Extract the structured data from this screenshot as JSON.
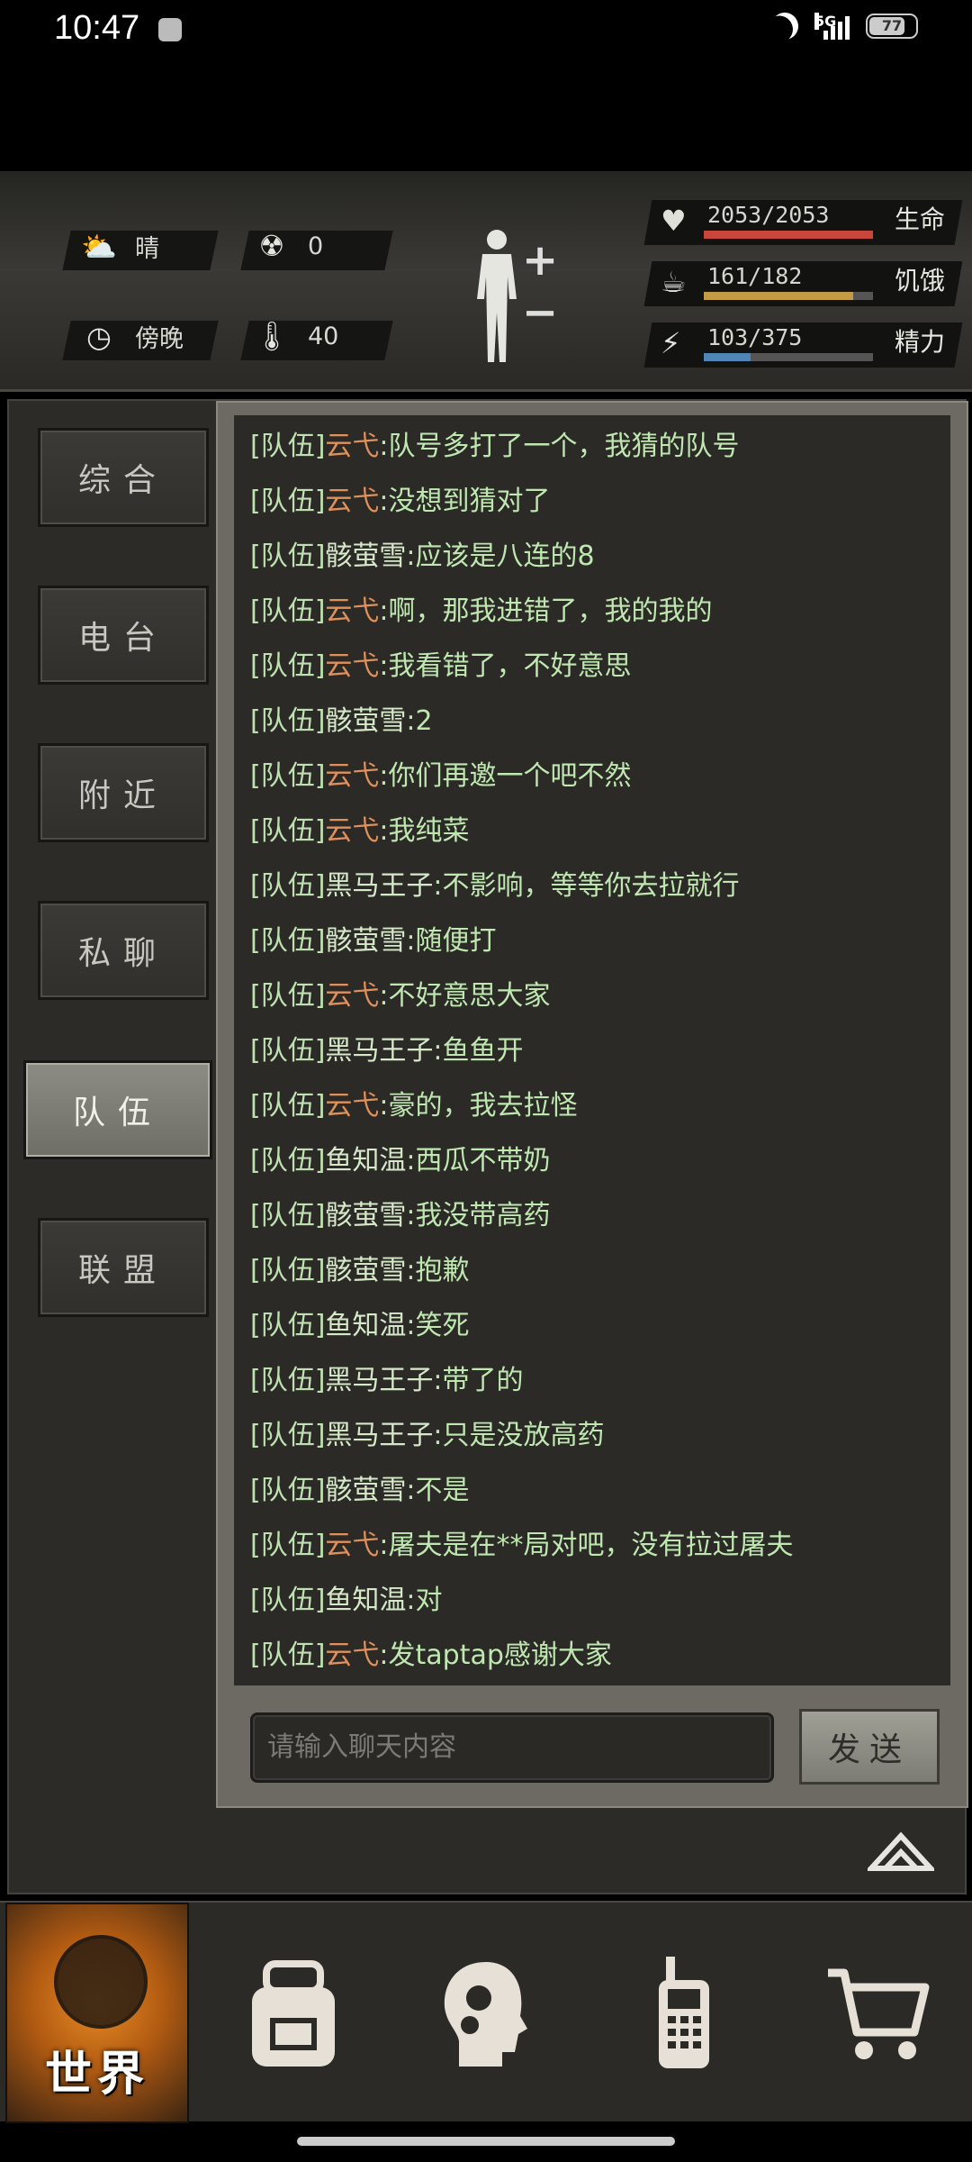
{
  "status_bar": {
    "time": "10:47",
    "network": "5G",
    "battery": "77"
  },
  "header": {
    "weather": {
      "icon": "cloud-sun-icon",
      "value": "晴"
    },
    "radiation": {
      "icon": "radiation-icon",
      "value": "0"
    },
    "time_of_day": {
      "icon": "clock-icon",
      "value": "傍晚"
    },
    "temperature": {
      "icon": "thermometer-icon",
      "value": "40"
    },
    "stats": [
      {
        "name": "生命",
        "value": "2053/2053",
        "fraction": 1.0,
        "color": "#c9473a",
        "icon": "heart-pulse-icon"
      },
      {
        "name": "饥饿",
        "value": "161/182",
        "fraction": 0.885,
        "color": "#c39a45",
        "icon": "stomach-icon"
      },
      {
        "name": "精力",
        "value": "103/375",
        "fraction": 0.275,
        "color": "#4f86b6",
        "icon": "energy-head-icon"
      }
    ]
  },
  "tabs": [
    {
      "label": "综合",
      "active": false
    },
    {
      "label": "电台",
      "active": false
    },
    {
      "label": "附近",
      "active": false
    },
    {
      "label": "私聊",
      "active": false
    },
    {
      "label": "队伍",
      "active": true
    },
    {
      "label": "联盟",
      "active": false
    }
  ],
  "messages": [
    {
      "tag": "[队伍]",
      "user": "云弋",
      "highlight": true,
      "text": ":队号多打了一个，我猜的队号"
    },
    {
      "tag": "[队伍]",
      "user": "云弋",
      "highlight": true,
      "text": ":没想到猜对了"
    },
    {
      "tag": "[队伍]",
      "user": "骸萤雪",
      "highlight": false,
      "text": ":应该是八连的8"
    },
    {
      "tag": "[队伍]",
      "user": "云弋",
      "highlight": true,
      "text": ":啊，那我进错了，我的我的"
    },
    {
      "tag": "[队伍]",
      "user": "云弋",
      "highlight": true,
      "text": ":我看错了，不好意思"
    },
    {
      "tag": "[队伍]",
      "user": "骸萤雪",
      "highlight": false,
      "text": ":2"
    },
    {
      "tag": "[队伍]",
      "user": "云弋",
      "highlight": true,
      "text": ":你们再邀一个吧不然"
    },
    {
      "tag": "[队伍]",
      "user": "云弋",
      "highlight": true,
      "text": ":我纯菜"
    },
    {
      "tag": "[队伍]",
      "user": "黑马王子",
      "highlight": false,
      "text": ":不影响，等等你去拉就行"
    },
    {
      "tag": "[队伍]",
      "user": "骸萤雪",
      "highlight": false,
      "text": ":随便打"
    },
    {
      "tag": "[队伍]",
      "user": "云弋",
      "highlight": true,
      "text": ":不好意思大家"
    },
    {
      "tag": "[队伍]",
      "user": "黑马王子",
      "highlight": false,
      "text": ":鱼鱼开"
    },
    {
      "tag": "[队伍]",
      "user": "云弋",
      "highlight": true,
      "text": ":豪的，我去拉怪"
    },
    {
      "tag": "[队伍]",
      "user": "鱼知温",
      "highlight": false,
      "text": ":西瓜不带奶"
    },
    {
      "tag": "[队伍]",
      "user": "骸萤雪",
      "highlight": false,
      "text": ":我没带高药"
    },
    {
      "tag": "[队伍]",
      "user": "骸萤雪",
      "highlight": false,
      "text": ":抱歉"
    },
    {
      "tag": "[队伍]",
      "user": "鱼知温",
      "highlight": false,
      "text": ":笑死"
    },
    {
      "tag": "[队伍]",
      "user": "黑马王子",
      "highlight": false,
      "text": ":带了的"
    },
    {
      "tag": "[队伍]",
      "user": "黑马王子",
      "highlight": false,
      "text": ":只是没放高药"
    },
    {
      "tag": "[队伍]",
      "user": "骸萤雪",
      "highlight": false,
      "text": ":不是"
    },
    {
      "tag": "[队伍]",
      "user": "云弋",
      "highlight": true,
      "text": ":屠夫是在**局对吧，没有拉过屠夫"
    },
    {
      "tag": "[队伍]",
      "user": "鱼知温",
      "highlight": false,
      "text": ":对"
    },
    {
      "tag": "[队伍]",
      "user": "云弋",
      "highlight": true,
      "text": ":发taptap感谢大家"
    }
  ],
  "chat_input": {
    "placeholder": "请输入聊天内容",
    "value": ""
  },
  "send_label": "发送",
  "bottom_nav": [
    {
      "label": "世界",
      "icon": "globe-icon",
      "active": true
    },
    {
      "label": "",
      "icon": "backpack-icon",
      "active": false
    },
    {
      "label": "",
      "icon": "head-gears-icon",
      "active": false
    },
    {
      "label": "",
      "icon": "radio-icon",
      "active": false
    },
    {
      "label": "",
      "icon": "cart-icon",
      "active": false
    }
  ]
}
